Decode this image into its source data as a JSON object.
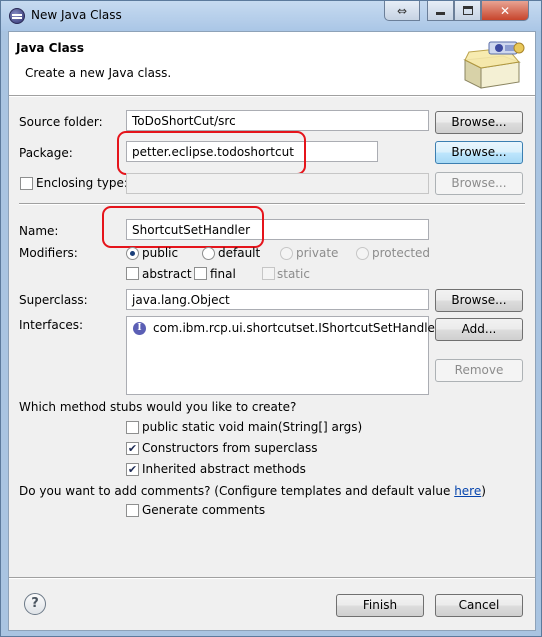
{
  "window": {
    "title": "New Java Class",
    "buttons": {
      "restore": "⇔",
      "close": "✕"
    }
  },
  "header": {
    "title": "Java Class",
    "description": "Create a new Java class."
  },
  "form": {
    "source_folder": {
      "label": "Source folder:",
      "value": "ToDoShortCut/src",
      "browse": "Browse..."
    },
    "package": {
      "label": "Package:",
      "value": "petter.eclipse.todoshortcut",
      "browse": "Browse..."
    },
    "enclosing_type": {
      "label": "Enclosing type:",
      "value": "",
      "browse": "Browse...",
      "checked": false
    },
    "name": {
      "label": "Name:",
      "value": "ShortcutSetHandler"
    },
    "modifiers": {
      "label": "Modifiers:",
      "public": "public",
      "default": "default",
      "private": "private",
      "protected": "protected",
      "abstract": "abstract",
      "final": "final",
      "static": "static",
      "selected": "public"
    },
    "superclass": {
      "label": "Superclass:",
      "value": "java.lang.Object",
      "browse": "Browse..."
    },
    "interfaces": {
      "label": "Interfaces:",
      "items": [
        "com.ibm.rcp.ui.shortcutset.IShortcutSetHandler"
      ],
      "add": "Add...",
      "remove": "Remove"
    }
  },
  "stubs": {
    "question": "Which method stubs would you like to create?",
    "options": [
      {
        "label": "public static void main(String[] args)",
        "checked": false
      },
      {
        "label": "Constructors from superclass",
        "checked": true
      },
      {
        "label": "Inherited abstract methods",
        "checked": true
      }
    ]
  },
  "comments": {
    "question": "Do you want to add comments? (Configure templates and default value ",
    "link": "here",
    "question_end": ")",
    "generate": {
      "label": "Generate comments",
      "checked": false
    }
  },
  "footer": {
    "help": "?",
    "finish": "Finish",
    "cancel": "Cancel"
  },
  "colors": {
    "highlight": "#e5141b",
    "window_frame": "#a9c4e1",
    "dialog_bg": "#f0f0f0"
  },
  "icons": {
    "app": "eclipse-icon",
    "wizard": "new-class-wizard-icon",
    "interface": "interface-icon",
    "help": "help-icon"
  }
}
